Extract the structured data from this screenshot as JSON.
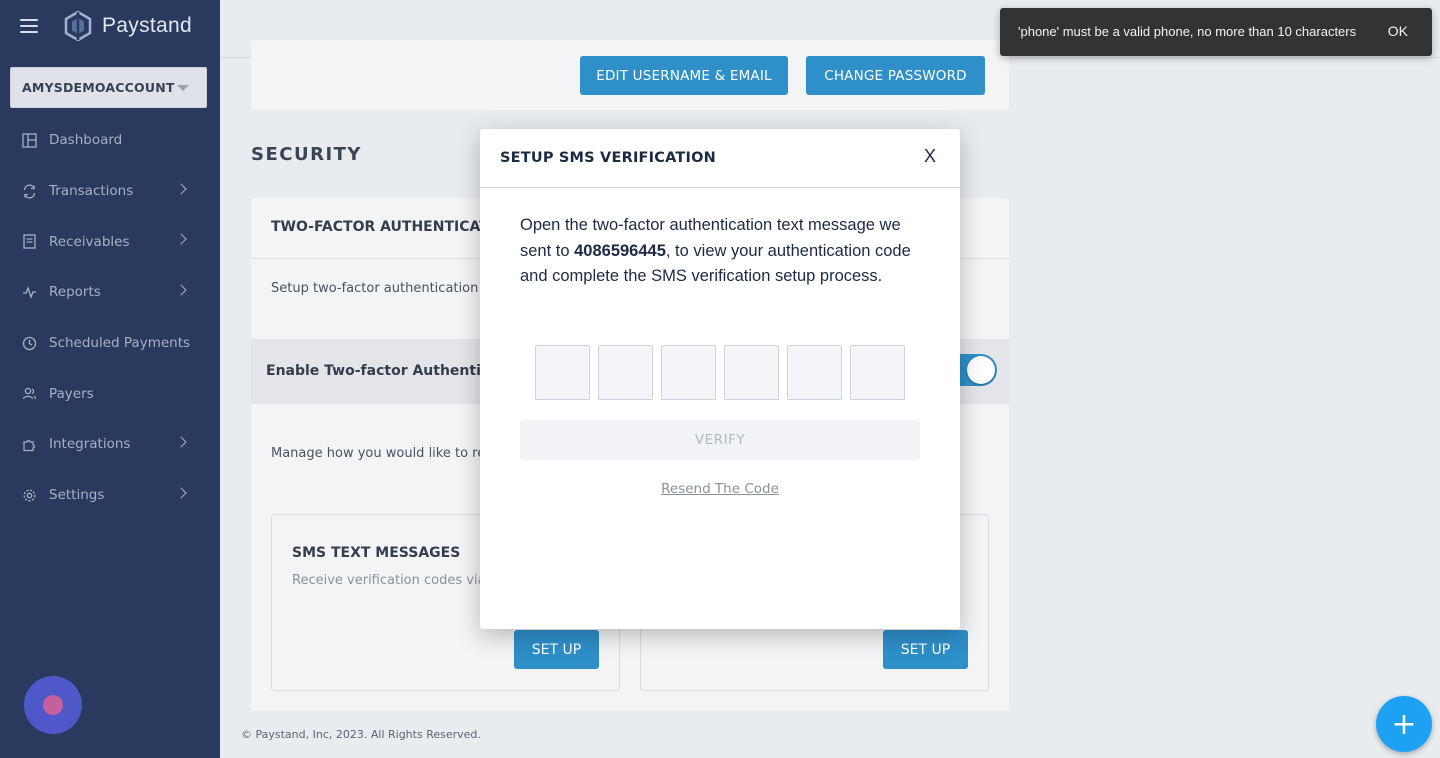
{
  "brand": {
    "name": "Paystand"
  },
  "sidebar": {
    "account": "AMYSDEMOACCOUNT",
    "items": [
      {
        "label": "Dashboard",
        "icon": "dashboard-icon",
        "has_submenu": false
      },
      {
        "label": "Transactions",
        "icon": "transactions-icon",
        "has_submenu": true
      },
      {
        "label": "Receivables",
        "icon": "receivables-icon",
        "has_submenu": true
      },
      {
        "label": "Reports",
        "icon": "reports-icon",
        "has_submenu": true
      },
      {
        "label": "Scheduled Payments",
        "icon": "clock-icon",
        "has_submenu": false
      },
      {
        "label": "Payers",
        "icon": "users-icon",
        "has_submenu": false
      },
      {
        "label": "Integrations",
        "icon": "puzzle-icon",
        "has_submenu": true
      },
      {
        "label": "Settings",
        "icon": "gear-icon",
        "has_submenu": true
      }
    ]
  },
  "account_card": {
    "edit_label": "EDIT USERNAME & EMAIL",
    "password_label": "CHANGE PASSWORD"
  },
  "security": {
    "title": "SECURITY",
    "card_title": "TWO-FACTOR AUTHENTICATIO",
    "description": "Setup two-factor authentication to",
    "enable_label": "Enable Two-factor Authentication",
    "enabled": true,
    "manage_text": "Manage how you would like to rece",
    "options": [
      {
        "title": "SMS TEXT MESSAGES",
        "desc": "Receive verification codes via t",
        "button": "SET UP"
      },
      {
        "title": "",
        "desc": "",
        "button": "SET UP"
      }
    ]
  },
  "modal": {
    "title": "SETUP SMS VERIFICATION",
    "close": "X",
    "msg_before": "Open the two-factor authentication text message we sent to ",
    "phone": "4086596445",
    "msg_after": ", to view your authentication code and complete the SMS verification setup process.",
    "code_digits": [
      "",
      "",
      "",
      "",
      "",
      ""
    ],
    "verify_label": "VERIFY",
    "resend_label": "Resend The Code"
  },
  "toast": {
    "message": "'phone' must be a valid phone, no more than 10 characters",
    "action": "OK"
  },
  "footer": {
    "copyright": "© Paystand, Inc, 2023. All Rights Reserved."
  },
  "fab": {
    "label": "+"
  },
  "colors": {
    "sidebar_bg": "#2a3a5e",
    "accent": "#2e8fc9",
    "toast_bg": "#333333",
    "fab": "#1da1f2"
  }
}
